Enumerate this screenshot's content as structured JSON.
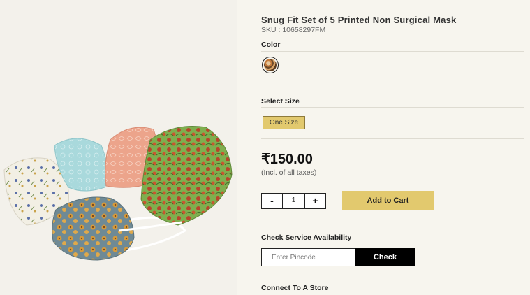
{
  "product": {
    "title": "Snug Fit Set of 5 Printed Non Surgical Mask",
    "sku": "SKU : 10658297FM"
  },
  "color_section": {
    "label": "Color",
    "swatch": "printed mustard floral"
  },
  "size_section": {
    "label": "Select Size",
    "selected": "One Size"
  },
  "pricing": {
    "price": "₹150.00",
    "tax_note": "(Incl. of all taxes)"
  },
  "quantity": {
    "minus": "-",
    "value": "1",
    "plus": "+"
  },
  "cart": {
    "add_label": "Add to Cart"
  },
  "service": {
    "label": "Check Service Availability",
    "placeholder": "Enter Pincode",
    "check_label": "Check"
  },
  "store": {
    "label": "Connect To A Store"
  },
  "colors": {
    "background": "#f7f5ee",
    "accent": "#e2c96e",
    "button_dark": "#000000"
  }
}
